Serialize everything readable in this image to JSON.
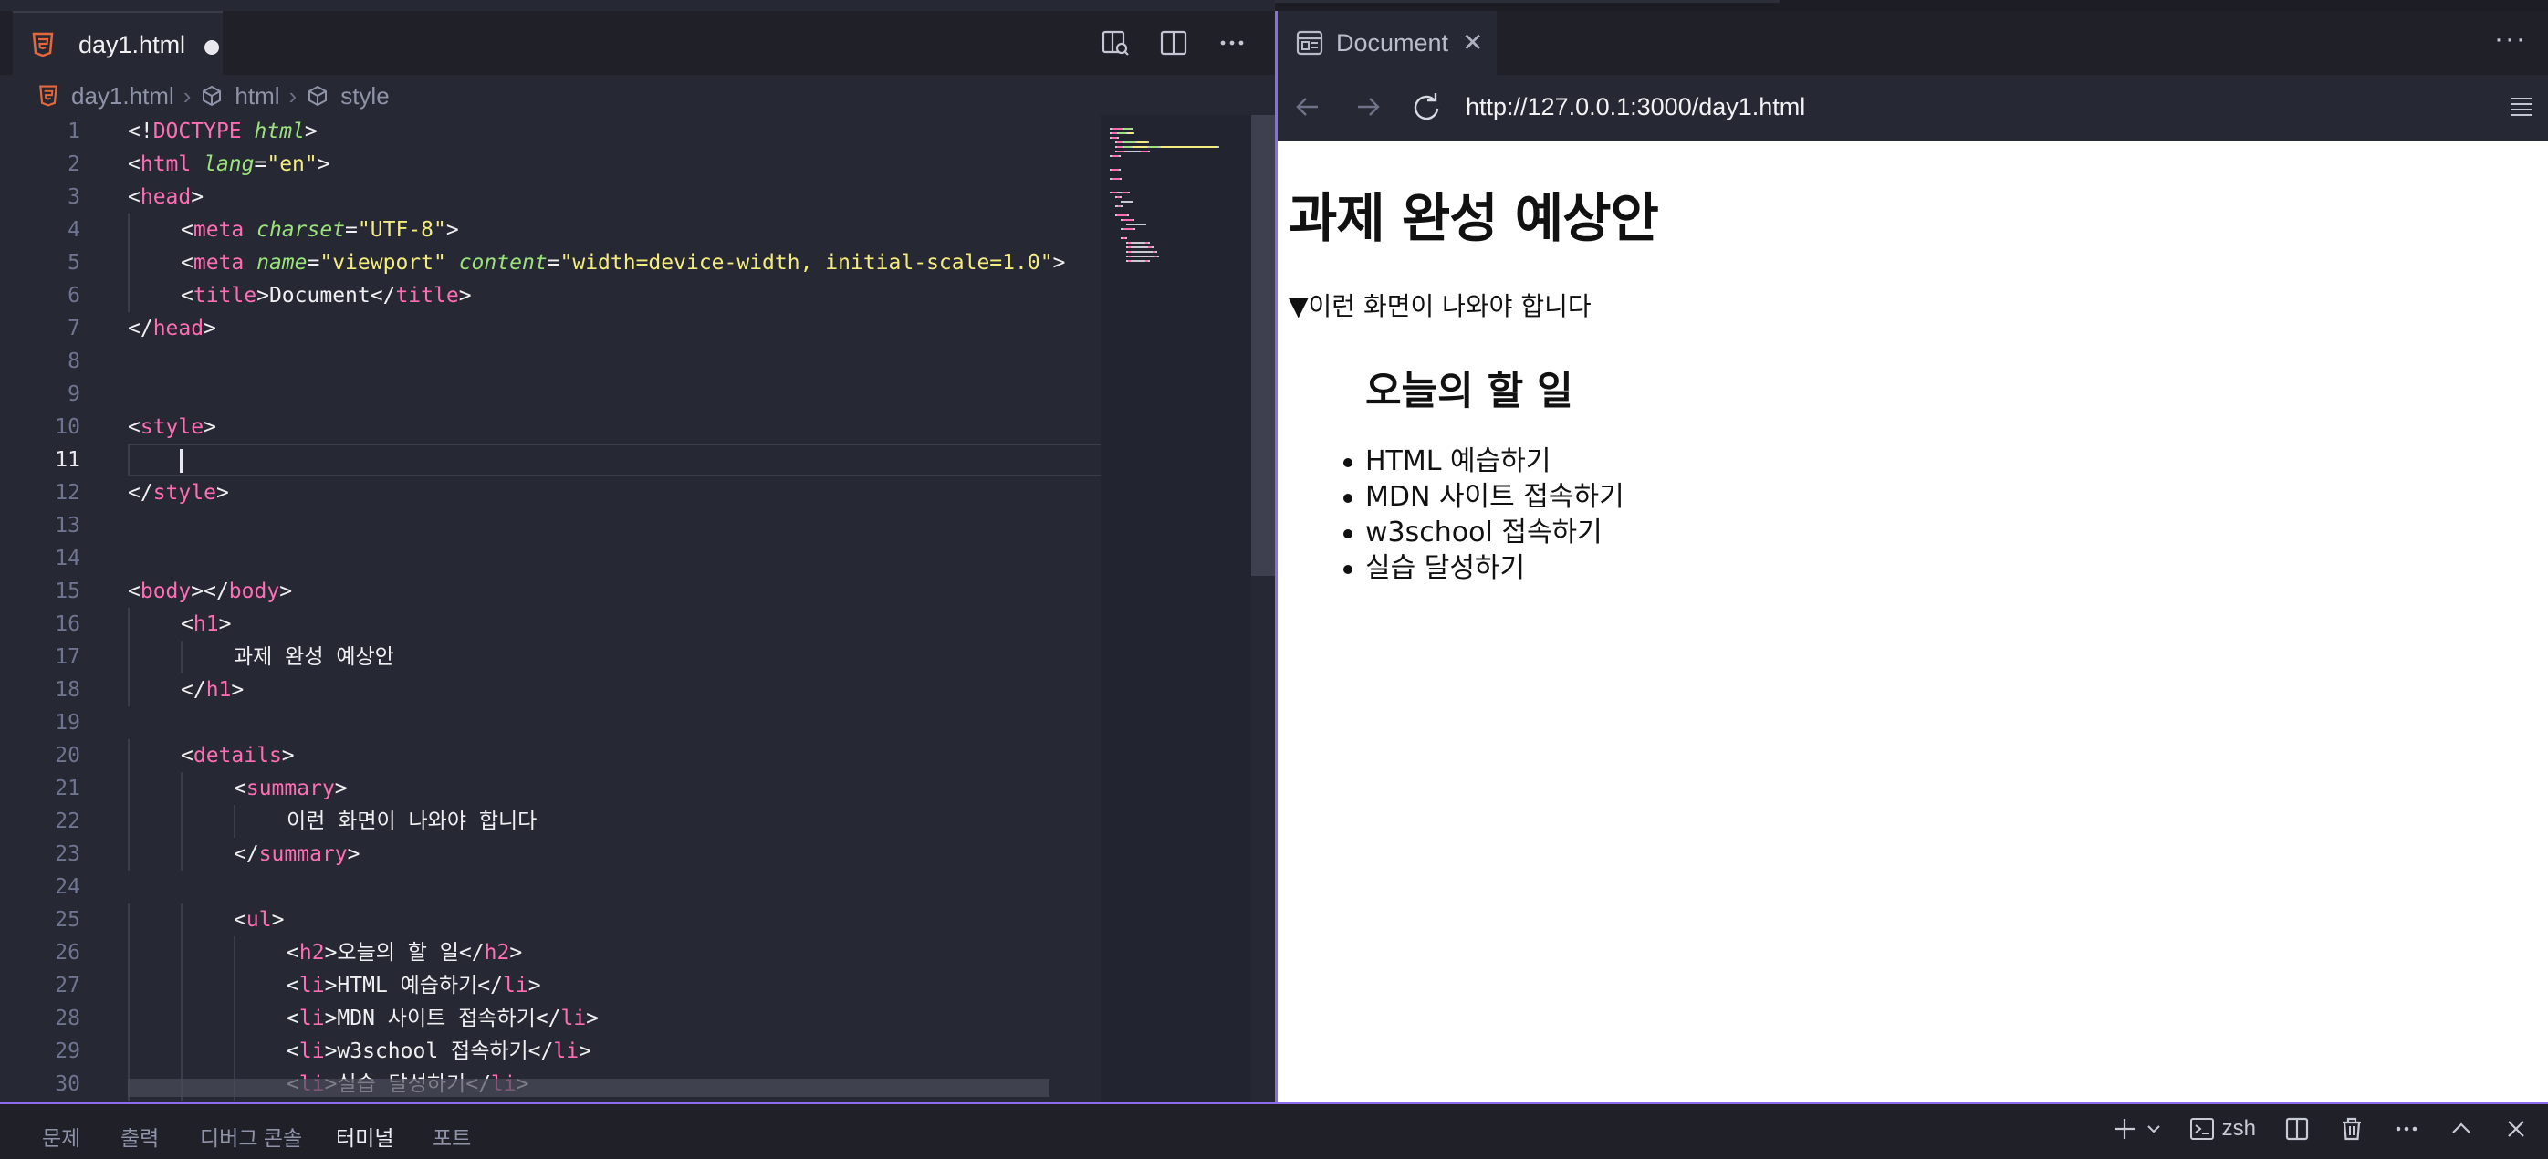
{
  "editor": {
    "tab_label": "day1.html",
    "breadcrumb": [
      "day1.html",
      "html",
      "style"
    ],
    "lines": [
      {
        "n": "1",
        "parts": [
          [
            "punc",
            "<!"
          ],
          [
            "tag",
            "DOCTYPE"
          ],
          [
            "punc",
            " "
          ],
          [
            "attr",
            "html"
          ],
          [
            "punc",
            ">"
          ]
        ]
      },
      {
        "n": "2",
        "parts": [
          [
            "punc",
            "<"
          ],
          [
            "tag",
            "html"
          ],
          [
            "punc",
            " "
          ],
          [
            "attr",
            "lang"
          ],
          [
            "punc",
            "="
          ],
          [
            "str",
            "\"en\""
          ],
          [
            "punc",
            ">"
          ]
        ]
      },
      {
        "n": "3",
        "parts": [
          [
            "punc",
            "<"
          ],
          [
            "tag",
            "head"
          ],
          [
            "punc",
            ">"
          ]
        ]
      },
      {
        "n": "4",
        "indent": 1,
        "parts": [
          [
            "punc",
            "<"
          ],
          [
            "tag",
            "meta"
          ],
          [
            "punc",
            " "
          ],
          [
            "attr",
            "charset"
          ],
          [
            "punc",
            "="
          ],
          [
            "str",
            "\"UTF-8\""
          ],
          [
            "punc",
            ">"
          ]
        ]
      },
      {
        "n": "5",
        "indent": 1,
        "parts": [
          [
            "punc",
            "<"
          ],
          [
            "tag",
            "meta"
          ],
          [
            "punc",
            " "
          ],
          [
            "attr",
            "name"
          ],
          [
            "punc",
            "="
          ],
          [
            "str",
            "\"viewport\""
          ],
          [
            "punc",
            " "
          ],
          [
            "attr",
            "content"
          ],
          [
            "punc",
            "="
          ],
          [
            "str",
            "\"width=device-width, initial-scale=1.0\""
          ],
          [
            "punc",
            ">"
          ]
        ]
      },
      {
        "n": "6",
        "indent": 1,
        "parts": [
          [
            "punc",
            "<"
          ],
          [
            "tag",
            "title"
          ],
          [
            "punc",
            ">Document</"
          ],
          [
            "tag",
            "title"
          ],
          [
            "punc",
            ">"
          ]
        ]
      },
      {
        "n": "7",
        "parts": [
          [
            "punc",
            "</"
          ],
          [
            "tag",
            "head"
          ],
          [
            "punc",
            ">"
          ]
        ]
      },
      {
        "n": "8",
        "parts": []
      },
      {
        "n": "9",
        "parts": []
      },
      {
        "n": "10",
        "parts": [
          [
            "punc",
            "<"
          ],
          [
            "tag",
            "style"
          ],
          [
            "punc",
            ">"
          ]
        ]
      },
      {
        "n": "11",
        "parts": []
      },
      {
        "n": "12",
        "parts": [
          [
            "punc",
            "</"
          ],
          [
            "tag",
            "style"
          ],
          [
            "punc",
            ">"
          ]
        ]
      },
      {
        "n": "13",
        "parts": []
      },
      {
        "n": "14",
        "parts": []
      },
      {
        "n": "15",
        "parts": [
          [
            "punc",
            "<"
          ],
          [
            "tag",
            "body"
          ],
          [
            "punc",
            "></"
          ],
          [
            "tag",
            "body"
          ],
          [
            "punc",
            ">"
          ]
        ]
      },
      {
        "n": "16",
        "indent": 1,
        "parts": [
          [
            "punc",
            "<"
          ],
          [
            "tag",
            "h1"
          ],
          [
            "punc",
            ">"
          ]
        ]
      },
      {
        "n": "17",
        "indent": 2,
        "parts": [
          [
            "punc",
            "과제 완성 예상안"
          ]
        ]
      },
      {
        "n": "18",
        "indent": 1,
        "parts": [
          [
            "punc",
            "</"
          ],
          [
            "tag",
            "h1"
          ],
          [
            "punc",
            ">"
          ]
        ]
      },
      {
        "n": "19",
        "parts": []
      },
      {
        "n": "20",
        "indent": 1,
        "parts": [
          [
            "punc",
            "<"
          ],
          [
            "tag",
            "details"
          ],
          [
            "punc",
            ">"
          ]
        ]
      },
      {
        "n": "21",
        "indent": 2,
        "parts": [
          [
            "punc",
            "<"
          ],
          [
            "tag",
            "summary"
          ],
          [
            "punc",
            ">"
          ]
        ]
      },
      {
        "n": "22",
        "indent": 3,
        "parts": [
          [
            "punc",
            "이런 화면이 나와야 합니다"
          ]
        ]
      },
      {
        "n": "23",
        "indent": 2,
        "parts": [
          [
            "punc",
            "</"
          ],
          [
            "tag",
            "summary"
          ],
          [
            "punc",
            ">"
          ]
        ]
      },
      {
        "n": "24",
        "parts": []
      },
      {
        "n": "25",
        "indent": 2,
        "parts": [
          [
            "punc",
            "<"
          ],
          [
            "tag",
            "ul"
          ],
          [
            "punc",
            ">"
          ]
        ]
      },
      {
        "n": "26",
        "indent": 3,
        "parts": [
          [
            "punc",
            "<"
          ],
          [
            "tag",
            "h2"
          ],
          [
            "punc",
            ">오늘의 할 일</"
          ],
          [
            "tag",
            "h2"
          ],
          [
            "punc",
            ">"
          ]
        ]
      },
      {
        "n": "27",
        "indent": 3,
        "parts": [
          [
            "punc",
            "<"
          ],
          [
            "tag",
            "li"
          ],
          [
            "punc",
            ">HTML 예습하기</"
          ],
          [
            "tag",
            "li"
          ],
          [
            "punc",
            ">"
          ]
        ]
      },
      {
        "n": "28",
        "indent": 3,
        "parts": [
          [
            "punc",
            "<"
          ],
          [
            "tag",
            "li"
          ],
          [
            "punc",
            ">MDN 사이트 접속하기</"
          ],
          [
            "tag",
            "li"
          ],
          [
            "punc",
            ">"
          ]
        ]
      },
      {
        "n": "29",
        "indent": 3,
        "parts": [
          [
            "punc",
            "<"
          ],
          [
            "tag",
            "li"
          ],
          [
            "punc",
            ">w3school 접속하기</"
          ],
          [
            "tag",
            "li"
          ],
          [
            "punc",
            ">"
          ]
        ]
      },
      {
        "n": "30",
        "indent": 3,
        "parts": [
          [
            "punc",
            "<"
          ],
          [
            "tag",
            "li"
          ],
          [
            "punc",
            ">실습 달성하기</"
          ],
          [
            "tag",
            "li"
          ],
          [
            "punc",
            ">"
          ]
        ]
      }
    ],
    "active_line": "11"
  },
  "browser": {
    "tab_label": "Document",
    "url": "http://127.0.0.1:3000/day1.html",
    "more_icon": "ellipsis-icon",
    "page": {
      "h1": "과제 완성 예상안",
      "summary": "▼이런 화면이 나와야 합니다",
      "h2": "오늘의 할 일",
      "items": [
        "HTML 예습하기",
        "MDN 사이트 접속하기",
        "w3school 접속하기",
        "실습 달성하기"
      ]
    }
  },
  "panel": {
    "tabs": [
      "문제",
      "출력",
      "디버그 콘솔",
      "터미널",
      "포트"
    ],
    "active_tab": "터미널",
    "terminal_name": "zsh"
  },
  "colors": {
    "accent": "#8b6cf0",
    "tag": "#ff6eb4",
    "attribute": "#9be27a",
    "string": "#f4ec7e",
    "html_icon": "#e5673c"
  }
}
